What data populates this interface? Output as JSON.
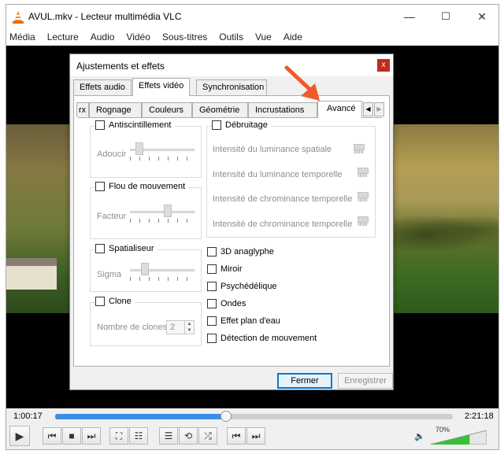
{
  "window": {
    "title": "AVUL.mkv - Lecteur multimédia VLC",
    "minimize": "—",
    "maximize": "☐",
    "close": "✕"
  },
  "menubar": [
    "Média",
    "Lecture",
    "Audio",
    "Vidéo",
    "Sous-titres",
    "Outils",
    "Vue",
    "Aide"
  ],
  "dialog": {
    "title": "Ajustements et effets",
    "close": "x",
    "main_tabs": [
      "Effets audio",
      "Effets vidéo",
      "Synchronisation"
    ],
    "active_main_tab": "Effets vidéo",
    "sub_tabs": [
      "rx",
      "Rognage",
      "Couleurs",
      "Géométrie",
      "Incrustations",
      "Avancé"
    ],
    "active_sub_tab": "Avancé",
    "groups": {
      "antiscintillement": {
        "label": "Antiscintillement",
        "slider_label": "Adoucir",
        "checked": false,
        "level": 0.1
      },
      "flou": {
        "label": "Flou de mouvement",
        "slider_label": "Facteur",
        "checked": false,
        "level": 0.6
      },
      "spatialiseur": {
        "label": "Spatialiseur",
        "slider_label": "Sigma",
        "checked": false,
        "level": 0.2
      },
      "clone": {
        "label": "Clone",
        "field_label": "Nombre de clones",
        "value": "2",
        "checked": false
      },
      "debruitage": {
        "label": "Débruitage",
        "checked": false,
        "items": [
          "Intensité du luminance spatiale",
          "Intensité du luminance temporelle",
          "Intensité de chrominance temporelle",
          "Intensité de chrominance temporelle"
        ]
      }
    },
    "checkboxes": [
      "3D anaglyphe",
      "Miroir",
      "Psychédélique",
      "Ondes",
      "Effet plan d'eau",
      "Détection de mouvement"
    ],
    "buttons": {
      "close": "Fermer",
      "save": "Enregistrer"
    }
  },
  "player": {
    "elapsed": "1:00:17",
    "total": "2:21:18",
    "progress": 0.43,
    "volume": "70%",
    "volume_level": 0.7
  },
  "annotation_color": "#f05a28",
  "icons": {
    "play": "▶",
    "prev": "⏮",
    "stop": "■",
    "next": "⏭",
    "fullscreen": "⛶",
    "settings": "☷",
    "playlist": "☰",
    "loop": "⟲",
    "shuffle": "⤮",
    "frame_prev": "⏮",
    "frame_next": "⏭",
    "speaker": "🔈"
  }
}
